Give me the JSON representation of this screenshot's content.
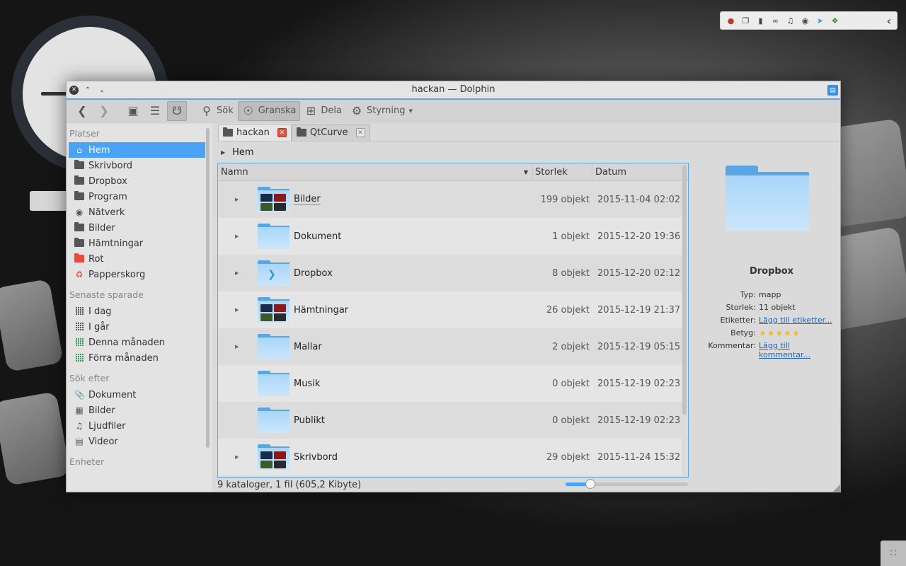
{
  "window": {
    "title": "hackan — Dolphin"
  },
  "toolbar": {
    "search": "Sök",
    "preview": "Granska",
    "share": "Dela",
    "control": "Styrning"
  },
  "places": {
    "sections": [
      {
        "title": "Platser",
        "items": [
          {
            "label": "Hem",
            "icon": "home-icon",
            "selected": true
          },
          {
            "label": "Skrivbord",
            "icon": "folder-icon"
          },
          {
            "label": "Dropbox",
            "icon": "folder-icon"
          },
          {
            "label": "Program",
            "icon": "folder-icon"
          },
          {
            "label": "Nätverk",
            "icon": "network-icon"
          },
          {
            "label": "Bilder",
            "icon": "folder-icon"
          },
          {
            "label": "Hämtningar",
            "icon": "folder-icon"
          },
          {
            "label": "Rot",
            "icon": "folder-red-icon"
          },
          {
            "label": "Papperskorg",
            "icon": "trash-icon"
          }
        ]
      },
      {
        "title": "Senaste sparade",
        "items": [
          {
            "label": "I dag",
            "icon": "calendar-icon"
          },
          {
            "label": "I går",
            "icon": "calendar-icon"
          },
          {
            "label": "Denna månaden",
            "icon": "calendar-green-icon"
          },
          {
            "label": "Förra månaden",
            "icon": "calendar-green-icon"
          }
        ]
      },
      {
        "title": "Sök efter",
        "items": [
          {
            "label": "Dokument",
            "icon": "paperclip-icon"
          },
          {
            "label": "Bilder",
            "icon": "image-icon"
          },
          {
            "label": "Ljudfiler",
            "icon": "music-icon"
          },
          {
            "label": "Videor",
            "icon": "film-icon"
          }
        ]
      },
      {
        "title": "Enheter",
        "items": []
      }
    ]
  },
  "tabs": [
    {
      "label": "hackan",
      "active": true
    },
    {
      "label": "QtCurve",
      "active": false
    }
  ],
  "breadcrumb": "Hem",
  "columns": {
    "name": "Namn",
    "size": "Storlek",
    "date": "Datum"
  },
  "files": [
    {
      "name": "Bilder",
      "size": "199 objekt",
      "date": "2015-11-04 02:02",
      "expandable": true,
      "preview": "photos"
    },
    {
      "name": "Dokument",
      "size": "1 objekt",
      "date": "2015-12-20 19:36",
      "expandable": true,
      "preview": "none"
    },
    {
      "name": "Dropbox",
      "size": "8 objekt",
      "date": "2015-12-20 02:12",
      "expandable": true,
      "preview": "dropbox"
    },
    {
      "name": "Hämtningar",
      "size": "26 objekt",
      "date": "2015-12-19 21:37",
      "expandable": true,
      "preview": "photos"
    },
    {
      "name": "Mallar",
      "size": "2 objekt",
      "date": "2015-12-19 05:15",
      "expandable": true,
      "preview": "none"
    },
    {
      "name": "Musik",
      "size": "0 objekt",
      "date": "2015-12-19 02:23",
      "expandable": false,
      "preview": "none"
    },
    {
      "name": "Publikt",
      "size": "0 objekt",
      "date": "2015-12-19 02:23",
      "expandable": false,
      "preview": "none"
    },
    {
      "name": "Skrivbord",
      "size": "29 objekt",
      "date": "2015-11-24 15:32",
      "expandable": true,
      "preview": "photos"
    }
  ],
  "status": "9 kataloger, 1 fil (605,2 Kibyte)",
  "zoom": {
    "level": 0.2
  },
  "info": {
    "name": "Dropbox",
    "type_label": "Typ:",
    "type": "mapp",
    "size_label": "Storlek:",
    "size": "11 objekt",
    "tags_label": "Etiketter:",
    "tags_link": "Lägg till etiketter...",
    "rating_label": "Betyg:",
    "rating": 5,
    "comment_label": "Kommentar:",
    "comment_link": "Lägg till kommentar..."
  },
  "colors": {
    "accent": "#4aa3f5",
    "folder": "#a9d6f9"
  }
}
